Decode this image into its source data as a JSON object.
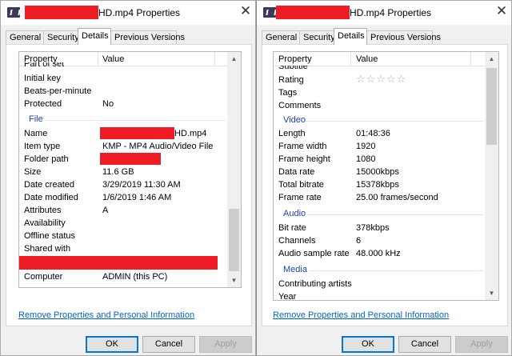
{
  "left": {
    "title_suffix": "HD.mp4 Properties",
    "tabs": [
      "General",
      "Security",
      "Details",
      "Previous Versions"
    ],
    "active_tab": "Details",
    "columns": [
      "Property",
      "Value"
    ],
    "rows_top": [
      {
        "property": "Part of set",
        "value": ""
      },
      {
        "property": "Initial key",
        "value": ""
      },
      {
        "property": "Beats-per-minute",
        "value": ""
      },
      {
        "property": "Protected",
        "value": "No"
      }
    ],
    "group_file": "File",
    "rows_file": [
      {
        "property": "Name",
        "value": "HD.mp4"
      },
      {
        "property": "Item type",
        "value": "KMP - MP4 Audio/Video File"
      },
      {
        "property": "Folder path",
        "value": ""
      },
      {
        "property": "Size",
        "value": "11.6 GB"
      },
      {
        "property": "Date created",
        "value": "3/29/2019 11:30 AM"
      },
      {
        "property": "Date modified",
        "value": "1/6/2019 1:46 AM"
      },
      {
        "property": "Attributes",
        "value": "A"
      },
      {
        "property": "Availability",
        "value": ""
      },
      {
        "property": "Offline status",
        "value": ""
      },
      {
        "property": "Shared with",
        "value": ""
      },
      {
        "property": "",
        "value": ""
      },
      {
        "property": "Computer",
        "value": "ADMIN (this PC)"
      }
    ],
    "remove_link": "Remove Properties and Personal Information",
    "buttons": {
      "ok": "OK",
      "cancel": "Cancel",
      "apply": "Apply"
    }
  },
  "right": {
    "title_suffix": "HD.mp4 Properties",
    "tabs": [
      "General",
      "Security",
      "Details",
      "Previous Versions"
    ],
    "active_tab": "Details",
    "columns": [
      "Property",
      "Value"
    ],
    "rows_top": [
      {
        "property": "Subtitle",
        "value": ""
      },
      {
        "property": "Rating",
        "value": "☆☆☆☆☆"
      },
      {
        "property": "Tags",
        "value": ""
      },
      {
        "property": "Comments",
        "value": ""
      }
    ],
    "group_video": "Video",
    "rows_video": [
      {
        "property": "Length",
        "value": "01:48:36"
      },
      {
        "property": "Frame width",
        "value": "1920"
      },
      {
        "property": "Frame height",
        "value": "1080"
      },
      {
        "property": "Data rate",
        "value": "15000kbps"
      },
      {
        "property": "Total bitrate",
        "value": "15378kbps"
      },
      {
        "property": "Frame rate",
        "value": "25.00 frames/second"
      }
    ],
    "group_audio": "Audio",
    "rows_audio": [
      {
        "property": "Bit rate",
        "value": "378kbps"
      },
      {
        "property": "Channels",
        "value": "6"
      },
      {
        "property": "Audio sample rate",
        "value": "48.000 kHz"
      }
    ],
    "group_media": "Media",
    "rows_media": [
      {
        "property": "Contributing artists",
        "value": ""
      },
      {
        "property": "Year",
        "value": ""
      }
    ],
    "remove_link": "Remove Properties and Personal Information",
    "buttons": {
      "ok": "OK",
      "cancel": "Cancel",
      "apply": "Apply"
    }
  },
  "colors": {
    "redaction": "#ee1c24",
    "group_header": "#1e3fae",
    "link": "#0066cc",
    "default_button_border": "#0078d7"
  },
  "icons": {
    "app": "kmplayer-icon",
    "close": "close-icon",
    "scroll_up": "scroll-up-arrow-icon",
    "scroll_down": "scroll-down-arrow-icon",
    "rating": "star-outline-icon"
  }
}
